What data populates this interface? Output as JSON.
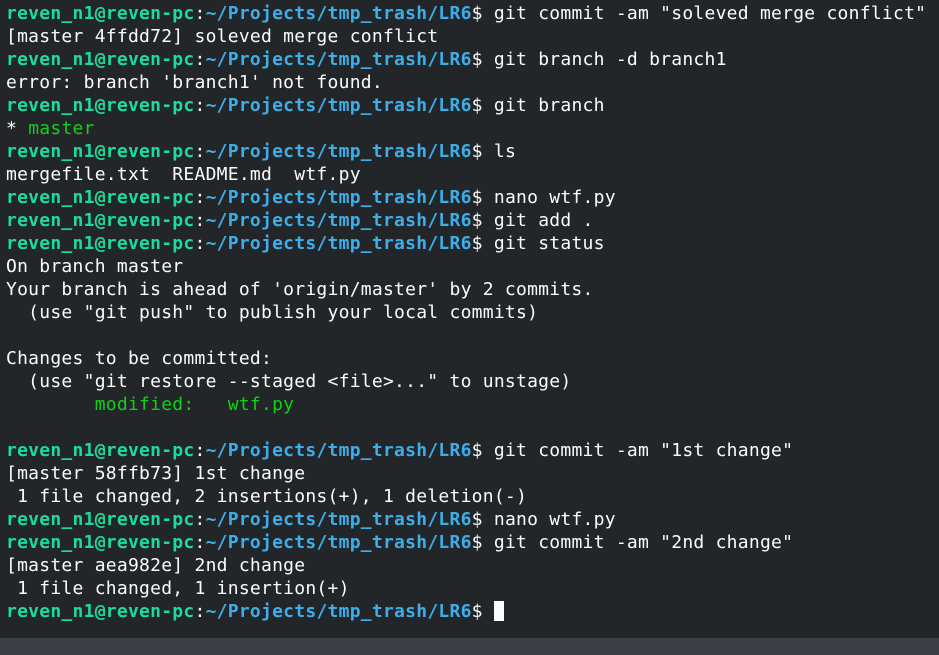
{
  "prompt": {
    "user_host": "reven_n1@reven-pc",
    "separator": ":",
    "path": "~/Projects/tmp_trash/LR6",
    "symbol": "$ "
  },
  "terminal_lines": {
    "l0_cmd": "git commit -am \"soleved merge conflict\"",
    "l1": "[master 4ffdd72] soleved merge conflict",
    "l2_cmd": "git branch -d branch1",
    "l3": "error: branch 'branch1' not found.",
    "l4_cmd": "git branch",
    "l5_star": "* ",
    "l5_branch": "master",
    "l6_cmd": "ls",
    "l7": "mergefile.txt  README.md  wtf.py",
    "l8_cmd": "nano wtf.py",
    "l9_cmd": "git add .",
    "l10_cmd": "git status",
    "l11": "On branch master",
    "l12": "Your branch is ahead of 'origin/master' by 2 commits.",
    "l13": "  (use \"git push\" to publish your local commits)",
    "l14": "",
    "l15": "Changes to be committed:",
    "l16": "  (use \"git restore --staged <file>...\" to unstage)",
    "l17_indent": "        ",
    "l17_modified": "modified:   wtf.py",
    "l18": "",
    "l19_cmd": "git commit -am \"1st change\"",
    "l20": "[master 58ffb73] 1st change",
    "l21": " 1 file changed, 2 insertions(+), 1 deletion(-)",
    "l22_cmd": "nano wtf.py",
    "l23_cmd": "git commit -am \"2nd change\"",
    "l24": "[master aea982e] 2nd change",
    "l25": " 1 file changed, 1 insertion(+)",
    "l26_cmd": ""
  },
  "colors": {
    "background": "#232629",
    "foreground": "#fcfcfc",
    "prompt_user": "#1cdc9a",
    "prompt_path": "#3daee9",
    "git_green": "#11d116"
  }
}
